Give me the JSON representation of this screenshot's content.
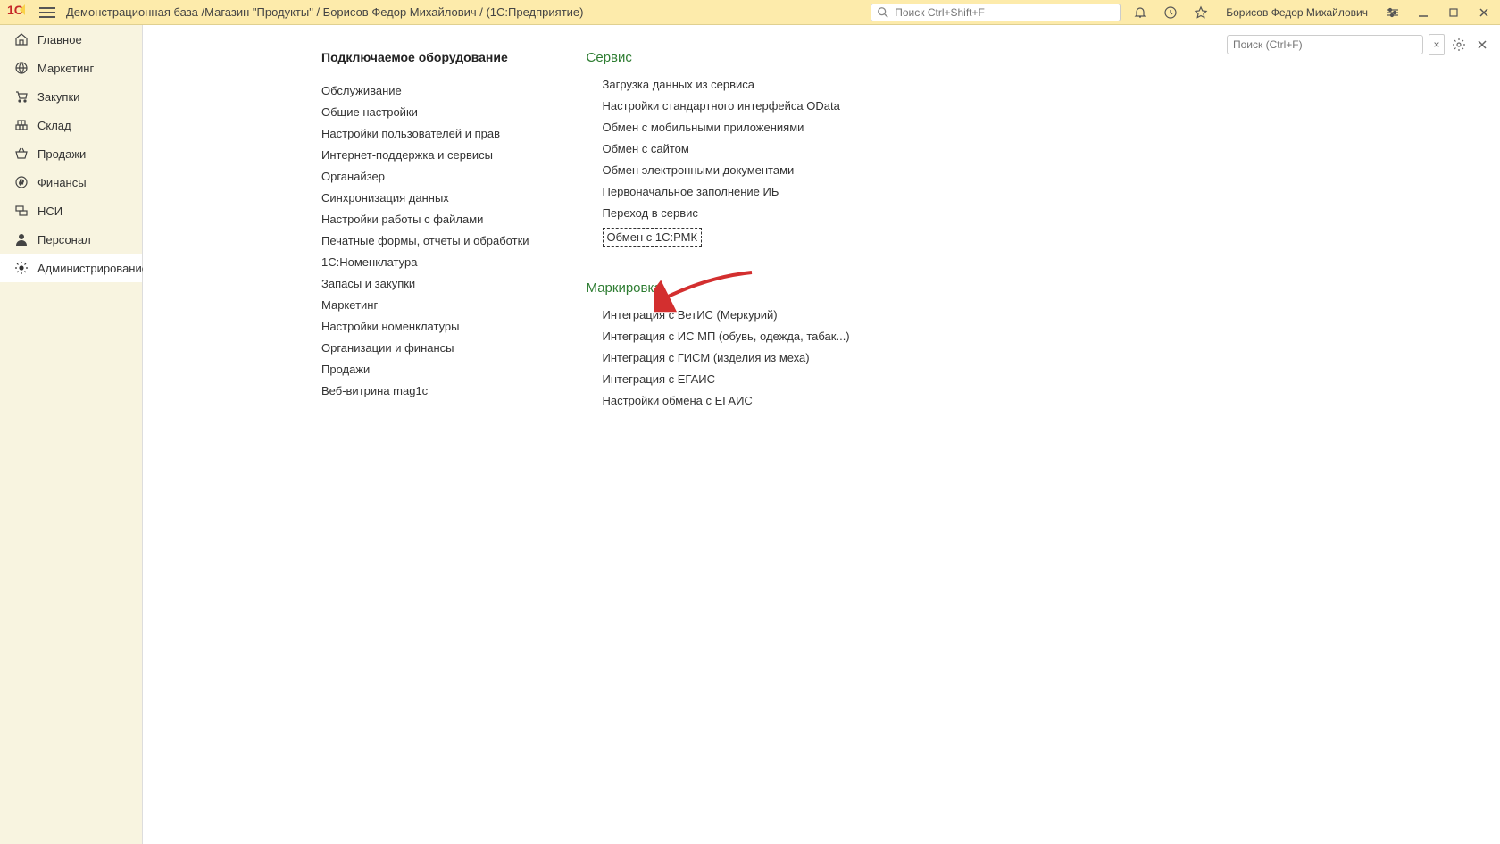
{
  "header": {
    "title": "Демонстрационная база /Магазин \"Продукты\" / Борисов Федор Михайлович /  (1С:Предприятие)",
    "search_placeholder": "Поиск Ctrl+Shift+F",
    "user_name": "Борисов Федор Михайлович"
  },
  "sidebar": {
    "items": [
      {
        "label": "Главное"
      },
      {
        "label": "Маркетинг"
      },
      {
        "label": "Закупки"
      },
      {
        "label": "Склад"
      },
      {
        "label": "Продажи"
      },
      {
        "label": "Финансы"
      },
      {
        "label": "НСИ"
      },
      {
        "label": "Персонал"
      },
      {
        "label": "Администрирование"
      }
    ]
  },
  "content": {
    "search_placeholder": "Поиск (Ctrl+F)",
    "left_column": {
      "heading": "Подключаемое оборудование",
      "items": [
        "Обслуживание",
        "Общие настройки",
        "Настройки пользователей и прав",
        "Интернет-поддержка и сервисы",
        "Органайзер",
        "Синхронизация данных",
        "Настройки работы с файлами",
        "Печатные формы, отчеты и обработки",
        "1С:Номенклатура",
        "Запасы и закупки",
        "Маркетинг",
        "Настройки номенклатуры",
        "Организации и финансы",
        "Продажи",
        "Веб-витрина mag1c"
      ]
    },
    "groups": [
      {
        "heading": "Сервис",
        "items": [
          "Загрузка данных из сервиса",
          "Настройки стандартного интерфейса OData",
          "Обмен с мобильными приложениями",
          "Обмен с сайтом",
          "Обмен электронными документами",
          "Первоначальное заполнение ИБ",
          "Переход в сервис",
          "Обмен с 1С:РМК"
        ]
      },
      {
        "heading": "Маркировка",
        "items": [
          "Интеграция с ВетИС (Меркурий)",
          "Интеграция с ИС МП (обувь, одежда, табак...)",
          "Интеграция с ГИСМ (изделия из меха)",
          "Интеграция с ЕГАИС",
          "Настройки обмена с ЕГАИС"
        ]
      }
    ]
  }
}
